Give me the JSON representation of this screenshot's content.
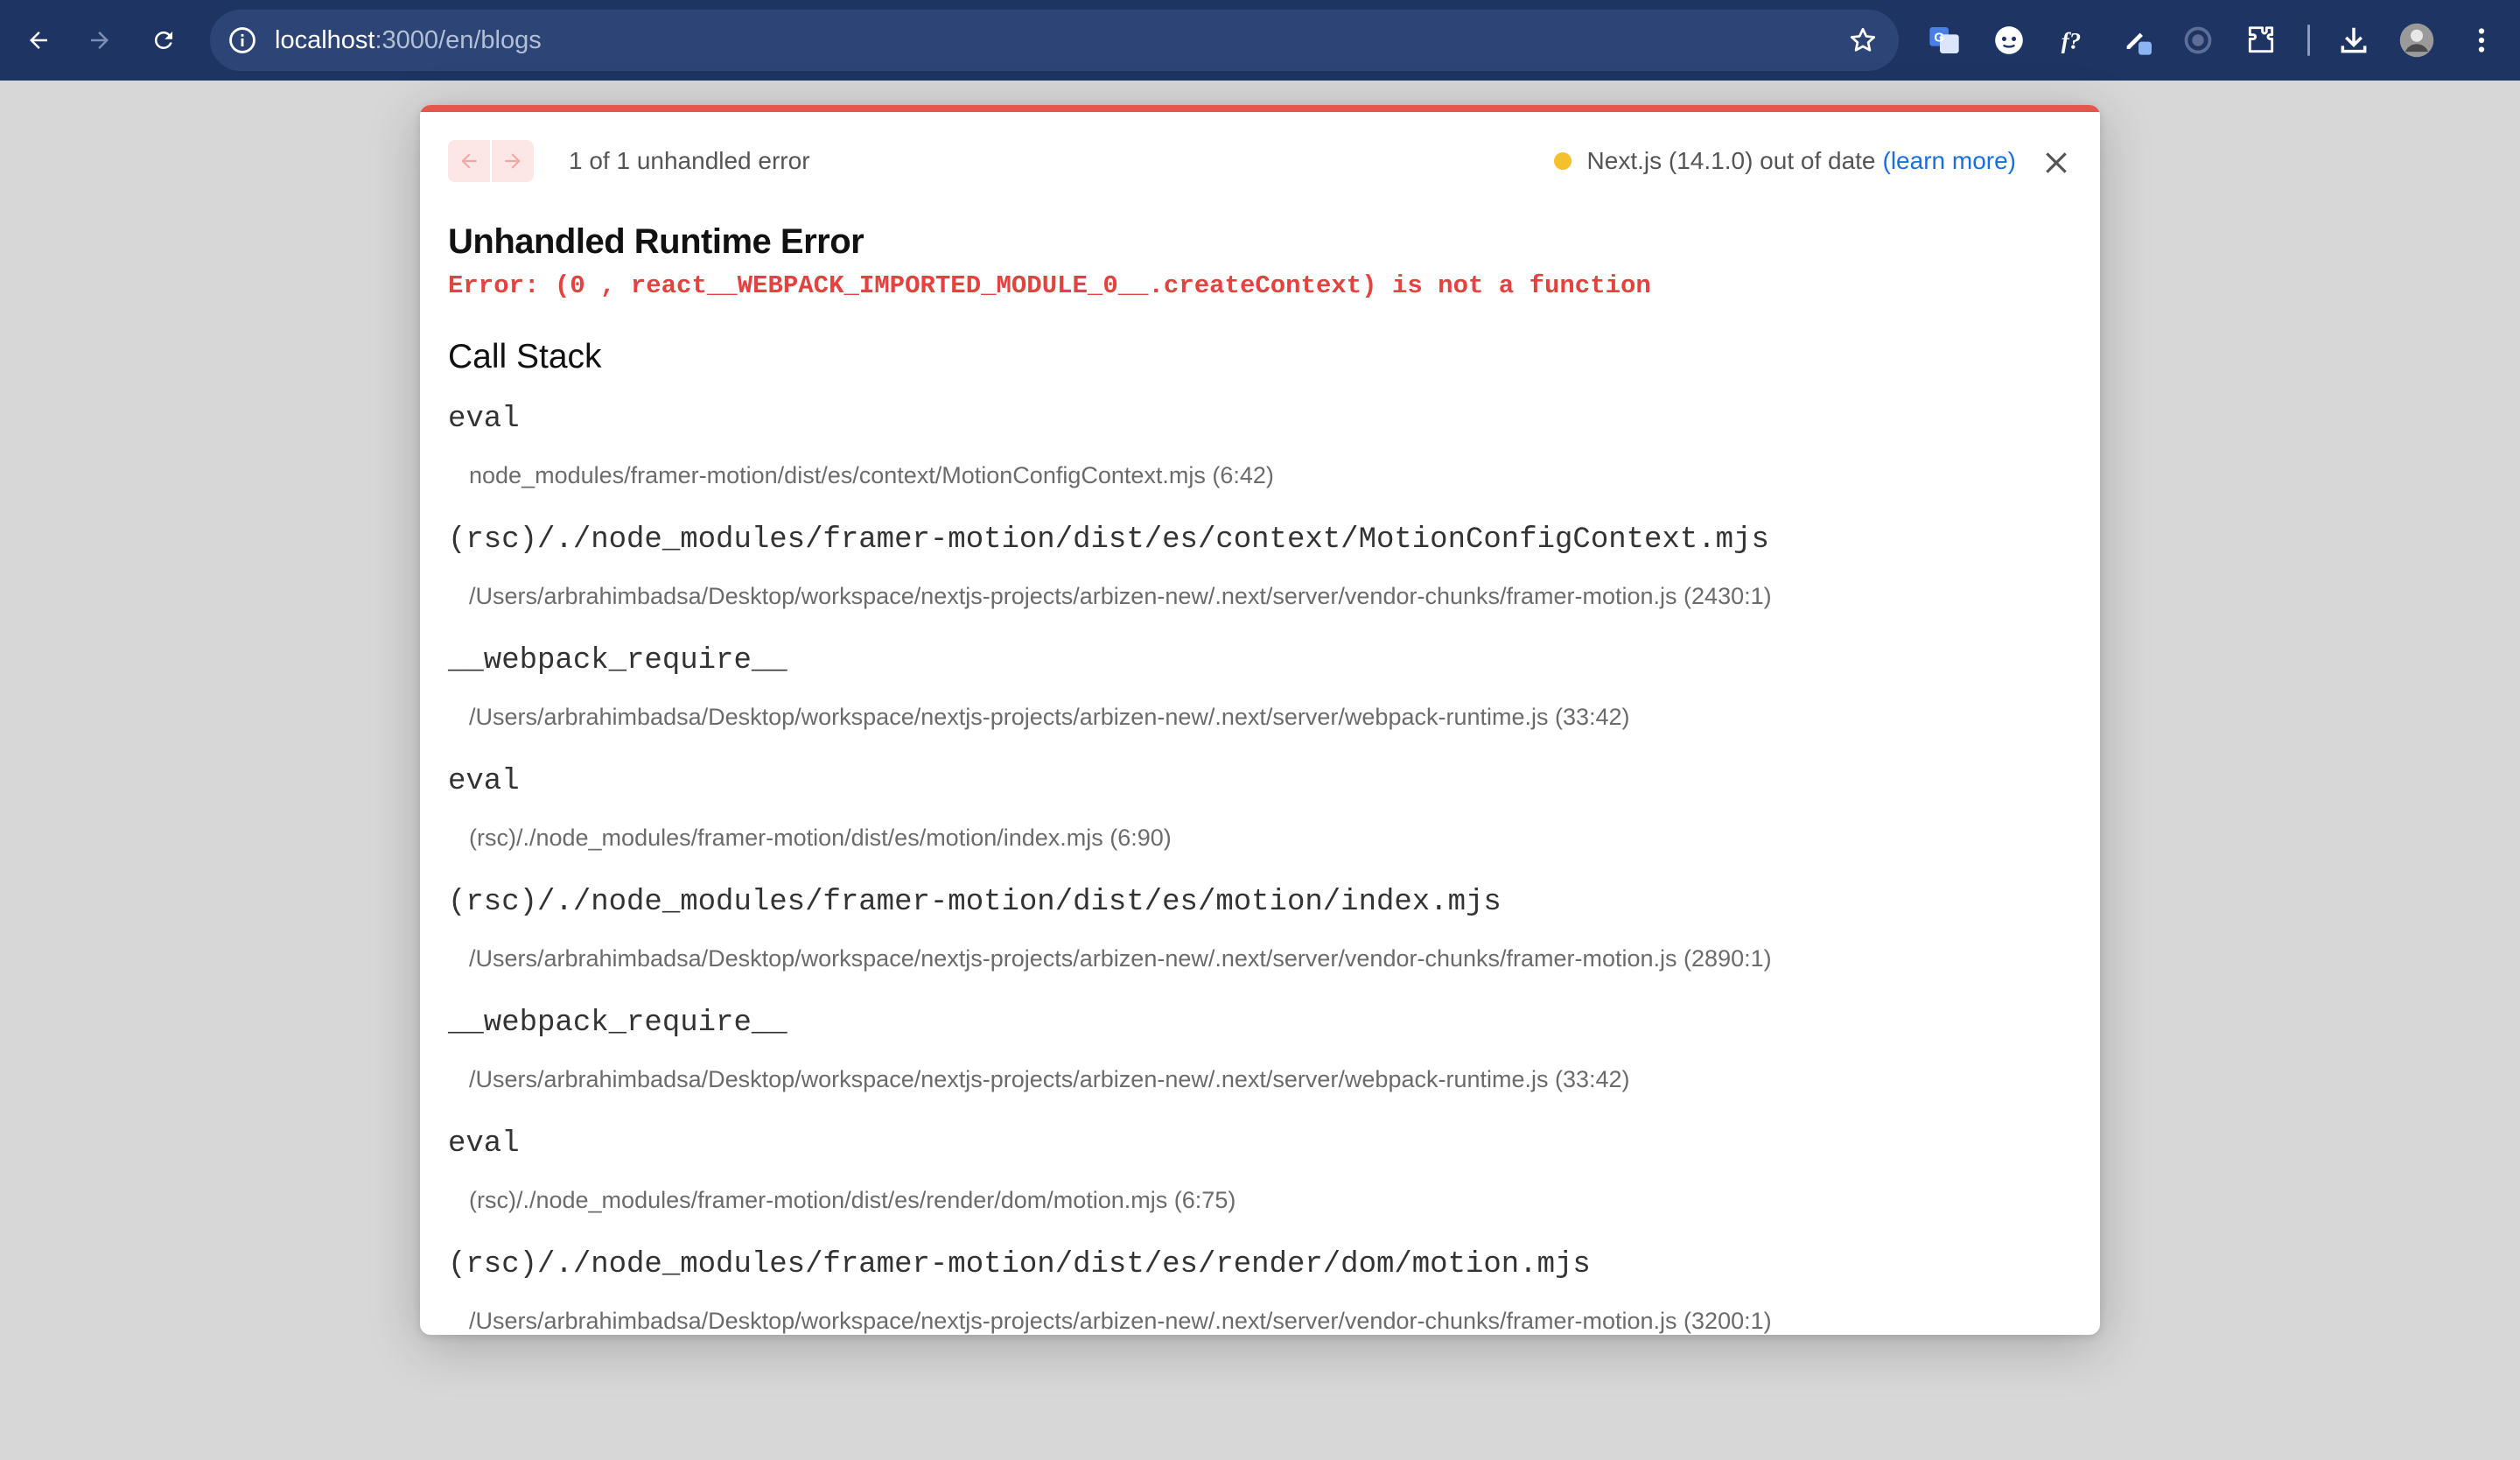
{
  "browser": {
    "url_host": "localhost",
    "url_path": ":3000/en/blogs"
  },
  "dialog": {
    "error_count": "1 of 1 unhandled error",
    "version_text": "Next.js (14.1.0) out of date",
    "learn_more": "(learn more)",
    "title": "Unhandled Runtime Error",
    "error_message": "Error: (0 , react__WEBPACK_IMPORTED_MODULE_0__.createContext) is not a function",
    "call_stack_heading": "Call Stack",
    "frames": [
      {
        "fn": "eval",
        "loc": "node_modules/framer-motion/dist/es/context/MotionConfigContext.mjs (6:42)"
      },
      {
        "fn": "(rsc)/./node_modules/framer-motion/dist/es/context/MotionConfigContext.mjs",
        "loc": "/Users/arbrahimbadsa/Desktop/workspace/nextjs-projects/arbizen-new/.next/server/vendor-chunks/framer-motion.js (2430:1)"
      },
      {
        "fn": "__webpack_require__",
        "loc": "/Users/arbrahimbadsa/Desktop/workspace/nextjs-projects/arbizen-new/.next/server/webpack-runtime.js (33:42)"
      },
      {
        "fn": "eval",
        "loc": "(rsc)/./node_modules/framer-motion/dist/es/motion/index.mjs (6:90)"
      },
      {
        "fn": "(rsc)/./node_modules/framer-motion/dist/es/motion/index.mjs",
        "loc": "/Users/arbrahimbadsa/Desktop/workspace/nextjs-projects/arbizen-new/.next/server/vendor-chunks/framer-motion.js (2890:1)"
      },
      {
        "fn": "__webpack_require__",
        "loc": "/Users/arbrahimbadsa/Desktop/workspace/nextjs-projects/arbizen-new/.next/server/webpack-runtime.js (33:42)"
      },
      {
        "fn": "eval",
        "loc": "(rsc)/./node_modules/framer-motion/dist/es/render/dom/motion.mjs (6:75)"
      },
      {
        "fn": "(rsc)/./node_modules/framer-motion/dist/es/render/dom/motion.mjs",
        "loc": "/Users/arbrahimbadsa/Desktop/workspace/nextjs-projects/arbizen-new/.next/server/vendor-chunks/framer-motion.js (3200:1)"
      }
    ]
  },
  "colors": {
    "toolbar": "#1e3564",
    "accent": "#e4574f",
    "error_text": "#e4423f",
    "link": "#1a6fe0",
    "warning_dot": "#f4c12d"
  },
  "icons": [
    "back-arrow-icon",
    "forward-arrow-icon",
    "reload-icon",
    "info-icon",
    "star-icon",
    "translate-icon",
    "emoji-extension-icon",
    "font-extension-icon",
    "pen-extension-icon",
    "record-extension-icon",
    "puzzle-icon",
    "download-icon",
    "avatar",
    "menu-dots-icon",
    "close-icon"
  ]
}
